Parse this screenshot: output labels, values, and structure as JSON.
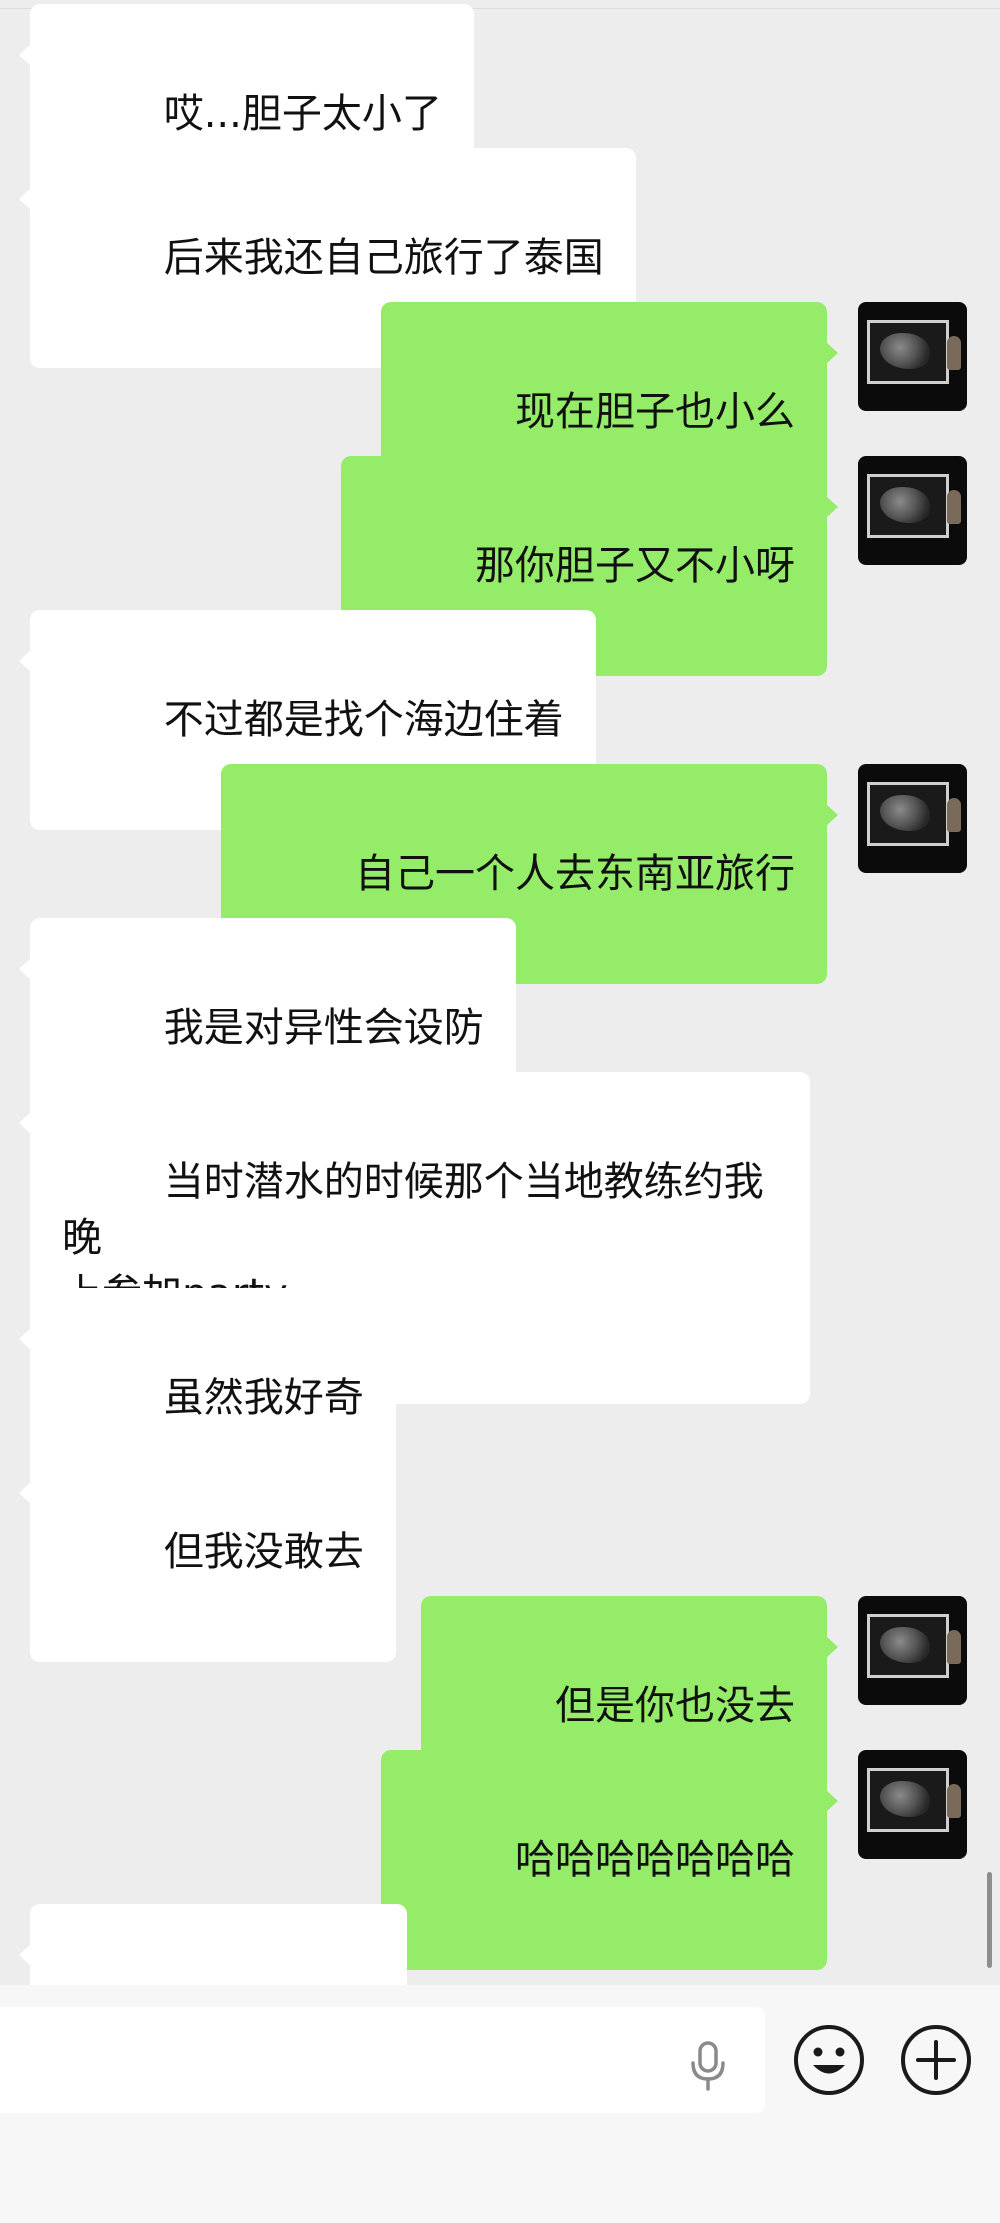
{
  "chat": {
    "messages": [
      {
        "side": "received",
        "text": "哎...胆子太小了"
      },
      {
        "side": "received",
        "text": "后来我还自己旅行了泰国"
      },
      {
        "side": "sent",
        "text": "现在胆子也小么"
      },
      {
        "side": "sent",
        "text": "那你胆子又不小呀"
      },
      {
        "side": "received",
        "text": "不过都是找个海边住着"
      },
      {
        "side": "sent",
        "text": "自己一个人去东南亚旅行"
      },
      {
        "side": "received",
        "text": "我是对异性会设防"
      },
      {
        "side": "received",
        "text": "当时潜水的时候那个当地教练约我晚\n上参加party"
      },
      {
        "side": "received",
        "text": "虽然我好奇"
      },
      {
        "side": "received",
        "text": "但我没敢去"
      },
      {
        "side": "sent",
        "text": "但是你也没去"
      },
      {
        "side": "sent",
        "text": "哈哈哈哈哈哈哈"
      },
      {
        "side": "received",
        "text": "😂😂😂😂"
      }
    ]
  },
  "input_bar": {
    "text_value": "",
    "icons": {
      "voice": "microphone-icon",
      "emoji": "smiley-face-icon",
      "more": "plus-circle-icon"
    }
  },
  "colors": {
    "background": "#ededed",
    "sent_bubble": "#95ec69",
    "received_bubble": "#ffffff",
    "text": "#111111",
    "icon": "#1a1a1a"
  }
}
